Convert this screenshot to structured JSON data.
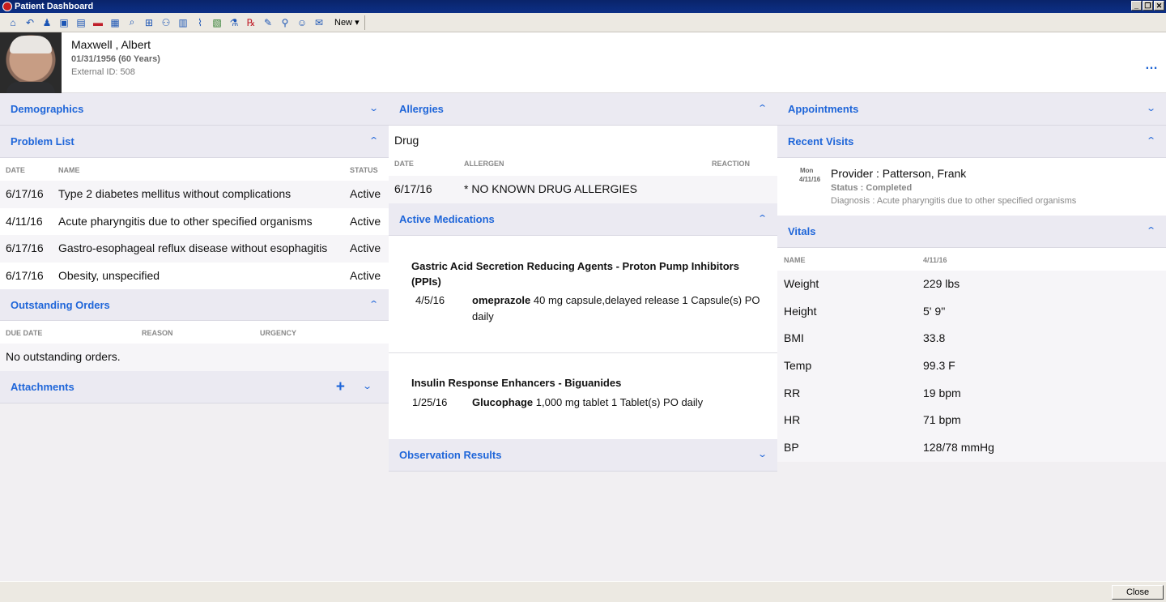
{
  "window": {
    "title": "Patient Dashboard",
    "new_label": "New"
  },
  "patient": {
    "name": "Maxwell , Albert",
    "dob": "01/31/1956 (60 Years)",
    "external_id": "External ID: 508",
    "more": "…"
  },
  "left": {
    "demographics": "Demographics",
    "problem_list": {
      "title": "Problem List",
      "headers": {
        "date": "DATE",
        "name": "NAME",
        "status": "STATUS"
      },
      "rows": [
        {
          "date": "6/17/16",
          "name": "Type 2 diabetes mellitus without complications",
          "status": "Active"
        },
        {
          "date": "4/11/16",
          "name": "Acute pharyngitis due to other specified organisms",
          "status": "Active"
        },
        {
          "date": "6/17/16",
          "name": "Gastro-esophageal reflux disease without esophagitis",
          "status": "Active"
        },
        {
          "date": "6/17/16",
          "name": "Obesity, unspecified",
          "status": "Active"
        }
      ]
    },
    "orders": {
      "title": "Outstanding Orders",
      "headers": {
        "due": "DUE DATE",
        "reason": "REASON",
        "urgency": "URGENCY"
      },
      "empty": "No outstanding orders."
    },
    "attachments": "Attachments"
  },
  "middle": {
    "allergies": {
      "title": "Allergies",
      "type": "Drug",
      "headers": {
        "date": "DATE",
        "allergen": "ALLERGEN",
        "reaction": "REACTION"
      },
      "row": {
        "date": "6/17/16",
        "allergen": "* NO KNOWN DRUG ALLERGIES",
        "reaction": ""
      }
    },
    "medications": {
      "title": "Active Medications",
      "groups": [
        {
          "class": "Gastric Acid Secretion Reducing Agents - Proton Pump Inhibitors (PPIs)",
          "date": "4/5/16",
          "drug": "omeprazole",
          "detail": "40 mg capsule,delayed release 1 Capsule(s) PO daily"
        },
        {
          "class": "Insulin Response Enhancers - Biguanides",
          "date": "1/25/16",
          "drug": "Glucophage",
          "detail": "1,000 mg tablet 1 Tablet(s) PO daily"
        }
      ]
    },
    "observations": "Observation Results"
  },
  "right": {
    "appointments": "Appointments",
    "recent_visits": {
      "title": "Recent Visits",
      "day": "Mon",
      "date": "4/11/16",
      "provider": "Provider : Patterson, Frank",
      "status": "Status : Completed",
      "diagnosis": "Diagnosis : Acute pharyngitis due to other specified organisms"
    },
    "vitals": {
      "title": "Vitals",
      "headers": {
        "name": "NAME",
        "date": "4/11/16"
      },
      "rows": [
        {
          "name": "Weight",
          "value": "229 lbs"
        },
        {
          "name": "Height",
          "value": "5' 9''"
        },
        {
          "name": "BMI",
          "value": "33.8"
        },
        {
          "name": "Temp",
          "value": "99.3 F"
        },
        {
          "name": "RR",
          "value": "19 bpm"
        },
        {
          "name": "HR",
          "value": "71 bpm"
        },
        {
          "name": "BP",
          "value": "128/78 mmHg"
        }
      ]
    }
  },
  "footer": {
    "close": "Close"
  },
  "colors": {
    "accent": "#1f66d9",
    "titlebar": "#0a246a",
    "section": "#ebeaf2"
  }
}
